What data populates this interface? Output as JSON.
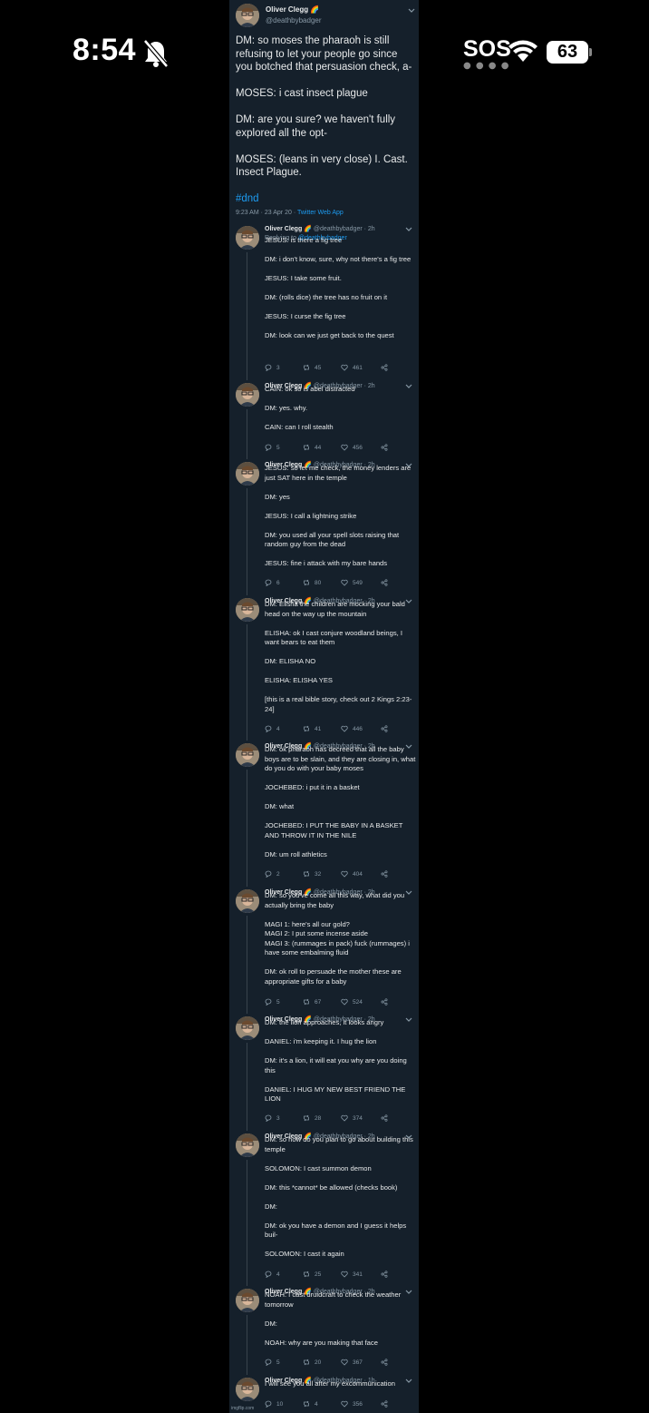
{
  "status_bar": {
    "time": "8:54",
    "carrier": "SOS",
    "battery": "63"
  },
  "main_tweet": {
    "name": "Oliver Clegg",
    "handle": "@deathbybadger",
    "text": "DM: so moses the pharaoh is still refusing to let your people go since you botched that persuasion check, a-\n\nMOSES: i cast insect plague\n\nDM: are you sure? we haven't fully explored all the opt-\n\nMOSES: (leans in very close) I. Cast. Insect Plague.",
    "hashtag": "#dnd",
    "meta": "9:23 AM · 23 Apr 20 · ",
    "app": "Twitter Web App"
  },
  "replies": [
    {
      "name": "Oliver Clegg",
      "meta": "@deathbybadger · 2h",
      "replying_label": "Replying to ",
      "replying_to": "@deathbybadger",
      "text": "JESUS: is there a fig tree\n\nDM: i don't know, sure, why not there's a fig tree\n\nJESUS: I take some fruit.\n\nDM: (rolls dice) the tree has no fruit on it\n\nJESUS: I curse the fig tree\n\nDM: look can we just get back to the quest",
      "replies": "3",
      "retweets": "45",
      "likes": "461"
    },
    {
      "name": "Oliver Clegg",
      "meta": "@deathbybadger · 2h",
      "text": "CAIN: ok so is abel distracted\n\nDM: yes. why.\n\nCAIN: can I roll stealth",
      "replies": "5",
      "retweets": "44",
      "likes": "456"
    },
    {
      "name": "Oliver Clegg",
      "meta": "@deathbybadger · 2h",
      "text": "JESUS: so let me check, the money lenders are just SAT here in the temple\n\nDM: yes\n\nJESUS: I call a lightning strike\n\nDM: you used all your spell slots raising that random guy from the dead\n\nJESUS: fine i attack with my bare hands",
      "replies": "6",
      "retweets": "80",
      "likes": "549"
    },
    {
      "name": "Oliver Clegg",
      "meta": "@deathbybadger · 2h",
      "text": "DM: Elisha the children are mocking your bald head on the way up the mountain\n\nELISHA: ok I cast conjure woodland beings, I want bears to eat them\n\nDM: ELISHA NO\n\nELISHA: ELISHA YES\n\n[this is a real bible story, check out 2 Kings 2:23-24]",
      "replies": "4",
      "retweets": "41",
      "likes": "446"
    },
    {
      "name": "Oliver Clegg",
      "meta": "@deathbybadger · 2h",
      "text": "DM: ok pharaoh has decreed that all the baby boys are to be slain, and they are closing in, what do you do with your baby moses\n\nJOCHEBED: i put it in a basket\n\nDM: what\n\nJOCHEBED: I PUT THE BABY IN A BASKET AND THROW IT IN THE NILE\n\nDM: um roll athletics",
      "replies": "2",
      "retweets": "32",
      "likes": "404"
    },
    {
      "name": "Oliver Clegg",
      "meta": "@deathbybadger · 2h",
      "text": "DM: so you've come all this way, what did you actually bring the baby\n\nMAGI 1: here's all our gold?\nMAGI 2: I put some incense aside\nMAGI 3: (rummages in pack) fuck (rummages) i have some embalming fluid\n\nDM: ok roll to persuade the mother these are appropriate gifts for a baby",
      "replies": "5",
      "retweets": "67",
      "likes": "524"
    },
    {
      "name": "Oliver Clegg",
      "meta": "@deathbybadger · 2h",
      "text": "DM: the lion approaches, it looks angry\n\nDANIEL: i'm keeping it. I hug the lion\n\nDM: it's a lion, it will eat you why are you doing this\n\nDANIEL: I HUG MY NEW BEST FRIEND THE LION",
      "replies": "3",
      "retweets": "28",
      "likes": "374"
    },
    {
      "name": "Oliver Clegg",
      "meta": "@deathbybadger · 2h",
      "text": "DM: so how do you plan to go about building this temple\n\nSOLOMON: I cast summon demon\n\nDM: this *cannot* be allowed (checks book)\n\nDM:\n\nDM: ok you have a demon and I guess it helps buil-\n\nSOLOMON: I cast it again",
      "replies": "4",
      "retweets": "25",
      "likes": "341"
    },
    {
      "name": "Oliver Clegg",
      "meta": "@deathbybadger · 2h",
      "text": "NOAH: I cast druidcraft to check the weather tomorrow\n\nDM:\n\nNOAH: why are you making that face",
      "replies": "5",
      "retweets": "20",
      "likes": "367"
    },
    {
      "name": "Oliver Clegg",
      "meta": "@deathbybadger · 1h",
      "text": "I will see you all after my excommunication",
      "replies": "10",
      "retweets": "4",
      "likes": "356"
    }
  ],
  "footer": {
    "watermark": "imgflip.com"
  },
  "colors": {
    "background": "#15202b",
    "text": "#e7e9ea",
    "muted": "#8899a6",
    "link": "#1d9bf0"
  }
}
